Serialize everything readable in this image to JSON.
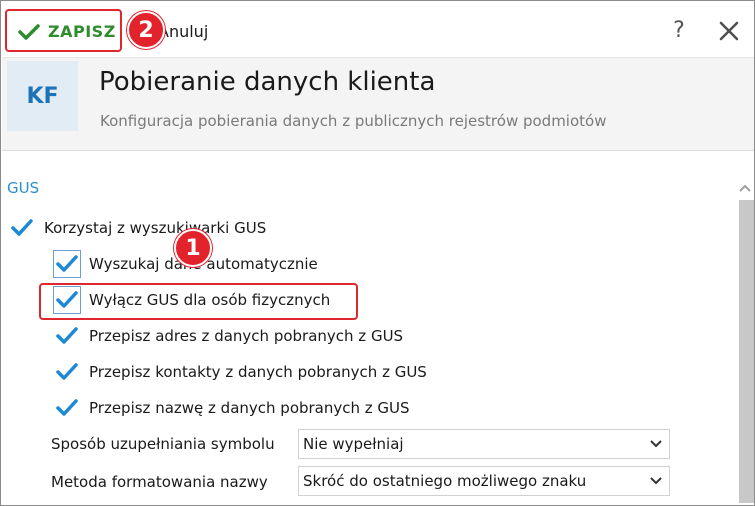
{
  "toolbar": {
    "save_label": "ZAPISZ",
    "cancel_label": "Anuluj",
    "help_label": "?"
  },
  "header": {
    "logo_text": "KF",
    "title": "Pobieranie danych klienta",
    "subtitle": "Konfiguracja pobierania danych z publicznych rejestrów podmiotów"
  },
  "section": {
    "title": "GUS",
    "main_checkbox": {
      "label": "Korzystaj z wyszukiwarki GUS",
      "checked": true
    },
    "options": [
      {
        "label": "Wyszukaj dane automatycznie",
        "checked": true
      },
      {
        "label": "Wyłącz GUS dla osób fizycznych",
        "checked": true
      },
      {
        "label": "Przepisz adres z danych pobranych z GUS",
        "checked": true
      },
      {
        "label": "Przepisz kontakty z danych pobranych z GUS",
        "checked": true
      },
      {
        "label": "Przepisz nazwę z danych pobranych z GUS",
        "checked": true
      }
    ],
    "symbol_fill": {
      "label": "Sposób uzupełniania symbolu",
      "value": "Nie wypełniaj"
    },
    "name_format": {
      "label": "Metoda formatowania nazwy",
      "value": "Skróć do ostatniego możliwego znaku"
    }
  },
  "annotations": {
    "badge_1": "1",
    "badge_2": "2"
  },
  "colors": {
    "accent": "#2a8fd1",
    "check": "#1e88d8",
    "save_green": "#2e8b2e",
    "annotation_red": "#e3232c"
  }
}
